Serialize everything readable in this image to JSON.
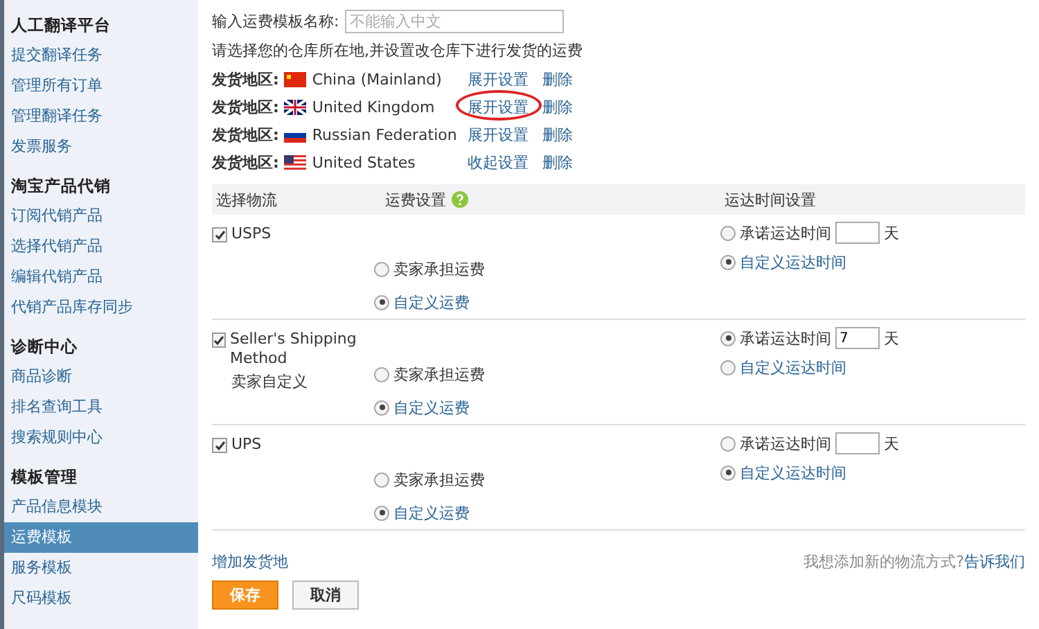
{
  "sidebar": {
    "sections": [
      {
        "title": "人工翻译平台",
        "items": [
          {
            "label": "提交翻译任务",
            "selected": false
          },
          {
            "label": "管理所有订单",
            "selected": false
          },
          {
            "label": "管理翻译任务",
            "selected": false
          },
          {
            "label": "发票服务",
            "selected": false
          }
        ]
      },
      {
        "title": "淘宝产品代销",
        "items": [
          {
            "label": "订阅代销产品",
            "selected": false
          },
          {
            "label": "选择代销产品",
            "selected": false
          },
          {
            "label": "编辑代销产品",
            "selected": false
          },
          {
            "label": "代销产品库存同步",
            "selected": false
          }
        ]
      },
      {
        "title": "诊断中心",
        "items": [
          {
            "label": "商品诊断",
            "selected": false
          },
          {
            "label": "排名查询工具",
            "selected": false
          },
          {
            "label": "搜索规则中心",
            "selected": false
          }
        ]
      },
      {
        "title": "模板管理",
        "items": [
          {
            "label": "产品信息模块",
            "selected": false
          },
          {
            "label": "运费模板",
            "selected": true
          },
          {
            "label": "服务模板",
            "selected": false
          },
          {
            "label": "尺码模板",
            "selected": false
          }
        ]
      }
    ]
  },
  "template_name": {
    "label": "输入运费模板名称:",
    "placeholder": "不能输入中文"
  },
  "hint": "请选择您的仓库所在地,并设置改仓库下进行发货的运费",
  "origins": [
    {
      "label": "发货地区:",
      "kind": "cn",
      "country": "China (Mainland)",
      "toggle": "展开设置",
      "delete": "删除",
      "circled": false
    },
    {
      "label": "发货地区:",
      "kind": "gb",
      "country": "United Kingdom",
      "toggle": "展开设置",
      "delete": "删除",
      "circled": true
    },
    {
      "label": "发货地区:",
      "kind": "ru",
      "country": "Russian Federation",
      "toggle": "展开设置",
      "delete": "删除",
      "circled": false
    },
    {
      "label": "发货地区:",
      "kind": "us",
      "country": "United States",
      "toggle": "收起设置",
      "delete": "删除",
      "circled": false
    }
  ],
  "table": {
    "columns": [
      "选择物流",
      "运费设置",
      "运达时间设置"
    ],
    "rows": [
      {
        "name": "USPS",
        "checked": true,
        "fee_options": [
          {
            "label": "卖家承担运费",
            "selected": false,
            "kind": "plain"
          },
          {
            "label": "自定义运费",
            "selected": true,
            "kind": "link"
          }
        ],
        "promise": {
          "label": "承诺运达时间",
          "unit": "天",
          "selected": false
        },
        "custom_time": {
          "label": "自定义运达时间",
          "selected": true
        }
      },
      {
        "name": "Seller's Shipping Method",
        "subname": "卖家自定义",
        "checked": true,
        "fee_options": [
          {
            "label": "卖家承担运费",
            "selected": false,
            "kind": "plain"
          },
          {
            "label": "自定义运费",
            "selected": true,
            "kind": "link"
          }
        ],
        "promise": {
          "label": "承诺运达时间",
          "value": "7",
          "unit": "天",
          "selected": true
        },
        "custom_time": {
          "label": "自定义运达时间",
          "selected": false
        }
      },
      {
        "name": "UPS",
        "checked": true,
        "fee_options": [
          {
            "label": "卖家承担运费",
            "selected": false,
            "kind": "plain"
          },
          {
            "label": "自定义运费",
            "selected": true,
            "kind": "link"
          }
        ],
        "promise": {
          "label": "承诺运达时间",
          "unit": "天",
          "selected": false
        },
        "custom_time": {
          "label": "自定义运达时间",
          "selected": true
        }
      }
    ]
  },
  "add_origin": "增加发货地",
  "feedback": {
    "text": "我想添加新的物流方式?",
    "link": "告诉我们"
  },
  "buttons": [
    {
      "label": "保存",
      "kind": "primary"
    },
    {
      "label": "取消",
      "kind": "secondary"
    }
  ]
}
